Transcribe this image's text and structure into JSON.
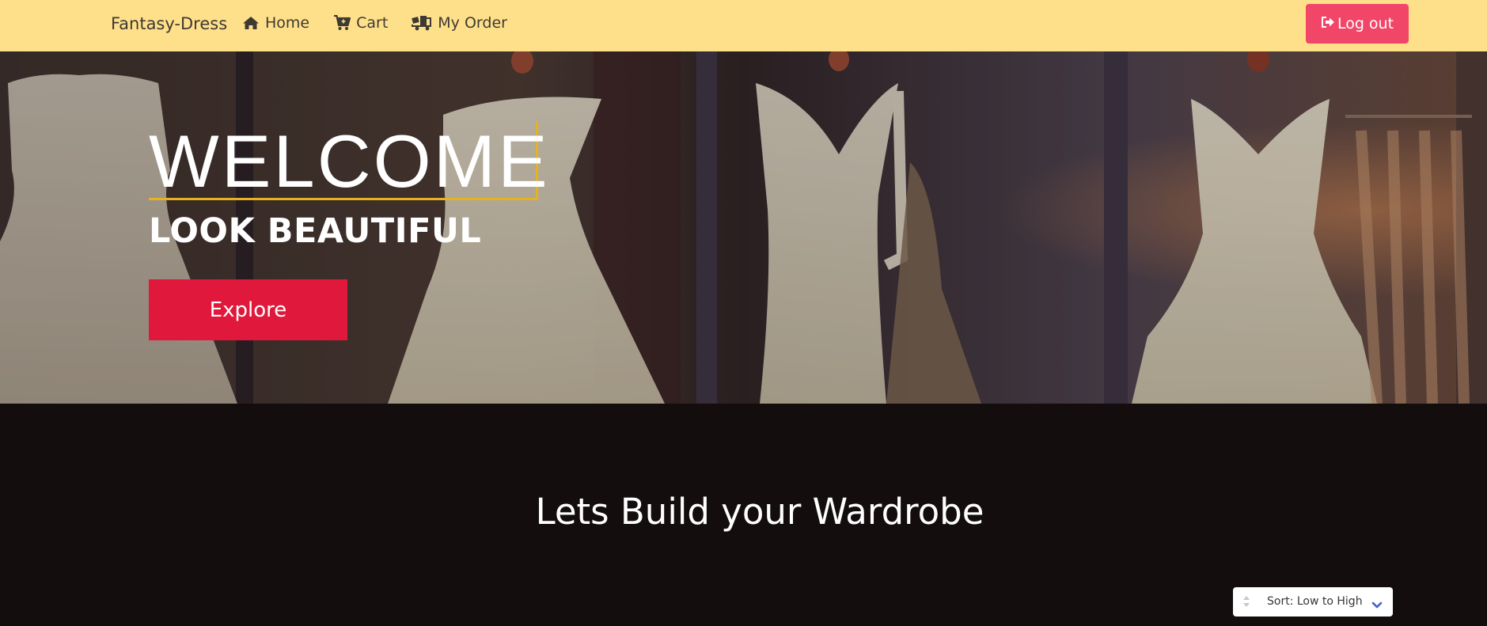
{
  "navbar": {
    "brand": "Fantasy-Dress",
    "links": [
      {
        "label": "Home",
        "icon": "home-icon"
      },
      {
        "label": "Cart",
        "icon": "cart-plus-icon"
      },
      {
        "label": "My Order",
        "icon": "truck-loading-icon"
      }
    ],
    "logout_label": "Log out",
    "logout_icon": "sign-out-icon",
    "background": "#ffe08a",
    "logout_color": "#f14668"
  },
  "hero": {
    "welcome": "WELCOME",
    "subtitle": "LOOK BEAUTIFUL",
    "explore_label": "Explore",
    "accent_underline": "#e6b220",
    "button_color": "#e0183c"
  },
  "section": {
    "title": "Lets Build your Wardrobe",
    "background": "#130d0e"
  },
  "sort": {
    "selected": "Sort: Low to High",
    "chevron_color": "#485fc7"
  }
}
